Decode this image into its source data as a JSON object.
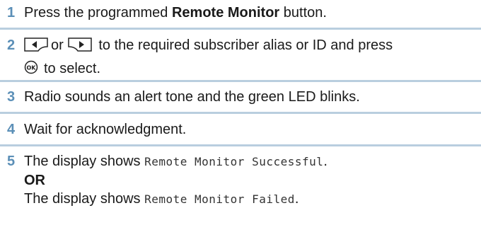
{
  "steps": [
    {
      "number": "1",
      "prefix": "Press the programmed ",
      "bold": "Remote Monitor",
      "suffix": " button."
    },
    {
      "number": "2",
      "or": "or",
      "line1_rest": " to the required subscriber alias or ID and press",
      "line2_rest": "to select."
    },
    {
      "number": "3",
      "text": "Radio sounds an alert tone and the green LED blinks."
    },
    {
      "number": "4",
      "text": "Wait for acknowledgment."
    },
    {
      "number": "5",
      "line1_prefix": "The display shows ",
      "line1_mono": "Remote Monitor Successful",
      "line1_suffix": ".",
      "or_label": "OR",
      "line3_prefix": "The display shows ",
      "line3_mono": "Remote Monitor Failed",
      "line3_suffix": "."
    }
  ],
  "icons": {
    "left_key": "left-arrow-key-icon",
    "right_key": "right-arrow-key-icon",
    "ok_key": "ok-button-icon"
  },
  "colors": {
    "step_number": "#5b8fb7",
    "divider": "#b9cedf",
    "text": "#1a1a1a"
  }
}
